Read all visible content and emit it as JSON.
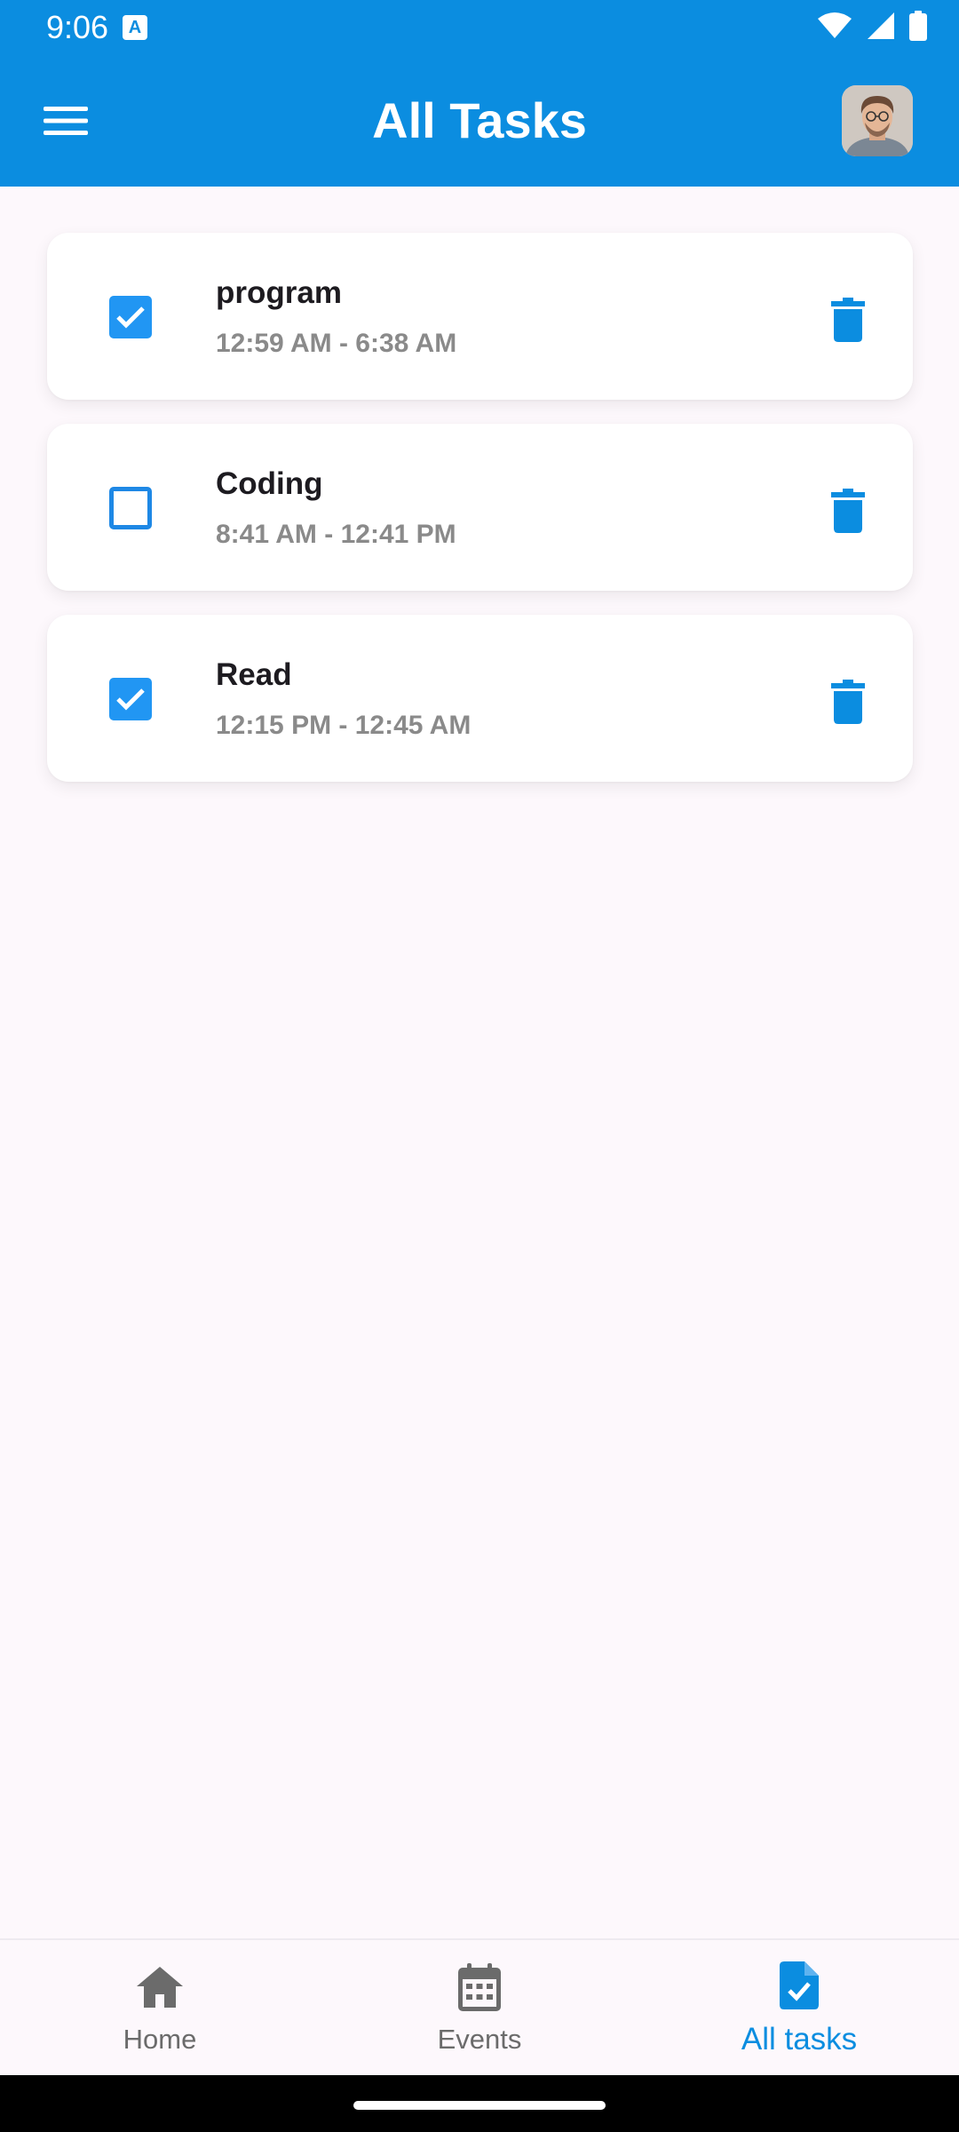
{
  "status_bar": {
    "time": "9:06",
    "notification_icon": "text-a-icon",
    "icons": [
      "wifi-icon",
      "cell-signal-icon",
      "battery-icon"
    ]
  },
  "app_bar": {
    "title": "All Tasks",
    "menu_icon": "hamburger-menu-icon",
    "avatar": "user-avatar"
  },
  "tasks": [
    {
      "title": "program",
      "time": "12:59 AM - 6:38 AM",
      "completed": true
    },
    {
      "title": "Coding",
      "time": "8:41 AM - 12:41 PM",
      "completed": false
    },
    {
      "title": "Read",
      "time": "12:15 PM - 12:45 AM",
      "completed": true
    }
  ],
  "bottom_nav": {
    "items": [
      {
        "label": "Home",
        "icon": "home-icon",
        "active": false
      },
      {
        "label": "Events",
        "icon": "calendar-icon",
        "active": false
      },
      {
        "label": "All tasks",
        "icon": "task-document-icon",
        "active": true
      }
    ]
  },
  "colors": {
    "primary": "#0b8de0",
    "checkbox": "#2196f3",
    "background": "#fdf8fc",
    "inactive_nav": "#6b6b6b"
  }
}
